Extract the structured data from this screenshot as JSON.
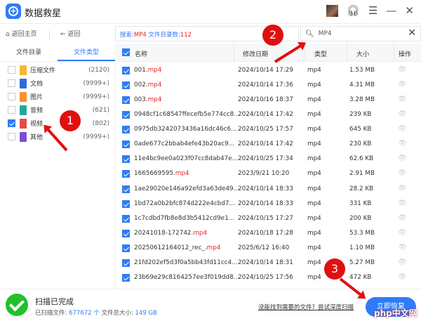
{
  "app": {
    "title": "数据救星",
    "logo_icon": "plus-circle-icon"
  },
  "toolbar": {
    "home": "返回主页",
    "back": "返回",
    "search_prefix": "搜索:",
    "search_term": "MP4",
    "dir_count_label": "文件目录数:",
    "dir_count": "112",
    "search_value": "MP4"
  },
  "left": {
    "tabs": [
      "文件目录",
      "文件类型"
    ],
    "active_tab": 1,
    "categories": [
      {
        "label": "压缩文件",
        "count": "(2120)",
        "checked": false,
        "color": "#f5b82e"
      },
      {
        "label": "文档",
        "count": "(9999+)",
        "checked": false,
        "color": "#2b6fd6"
      },
      {
        "label": "图片",
        "count": "(9999+)",
        "checked": false,
        "color": "#f7912e"
      },
      {
        "label": "音频",
        "count": "(621)",
        "checked": false,
        "color": "#23a79a"
      },
      {
        "label": "视频",
        "count": "(802)",
        "checked": true,
        "color": "#e84a4a"
      },
      {
        "label": "其他",
        "count": "(9999+)",
        "checked": false,
        "color": "#7a4fd0"
      }
    ]
  },
  "table": {
    "headers": [
      "名称",
      "修改日期",
      "类型",
      "大小",
      "操作"
    ],
    "rows": [
      {
        "name": "001.",
        "ext": "mp4",
        "date": "2024/10/14 17:29",
        "type": "mp4",
        "size": "1.53 MB"
      },
      {
        "name": "002.",
        "ext": "mp4",
        "date": "2024/10/14 17:36",
        "type": "mp4",
        "size": "4.31 MB"
      },
      {
        "name": "003.",
        "ext": "mp4",
        "date": "2024/10/16 18:37",
        "type": "mp4",
        "size": "3.28 MB"
      },
      {
        "name": "0948cf1c68547ffecefb5e774cc8...",
        "ext": "",
        "date": "2024/10/14 17:42",
        "type": "mp4",
        "size": "239 KB"
      },
      {
        "name": "0975db3242073436a16dc46c6...",
        "ext": "",
        "date": "2024/10/25 17:57",
        "type": "mp4",
        "size": "645 KB"
      },
      {
        "name": "0ade677c2bbab4efe43b20ac9...",
        "ext": "",
        "date": "2024/10/14 17:42",
        "type": "mp4",
        "size": "230 KB"
      },
      {
        "name": "11e4bc9ee0a023f07cc8dab47e...",
        "ext": "",
        "date": "2024/10/25 17:34",
        "type": "mp4",
        "size": "62.6 KB"
      },
      {
        "name": "1665669595.",
        "ext": "mp4",
        "date": "2023/9/21 10:20",
        "type": "mp4",
        "size": "2.91 MB"
      },
      {
        "name": "1ae29020e146a92efd3a63de49...",
        "ext": "",
        "date": "2024/10/14 18:33",
        "type": "mp4",
        "size": "28.2 KB"
      },
      {
        "name": "1bd72a0b2bfc874d222e4cbd7...",
        "ext": "",
        "date": "2024/10/14 18:33",
        "type": "mp4",
        "size": "331 KB"
      },
      {
        "name": "1c7cdbd7fb8e8d3b5412cd9e1...",
        "ext": "",
        "date": "2024/10/15 17:27",
        "type": "mp4",
        "size": "200 KB"
      },
      {
        "name": "20241018-172742.",
        "ext": "mp4",
        "date": "2024/10/18 17:28",
        "type": "mp4",
        "size": "53.3 MB"
      },
      {
        "name": "20250612164012_rec_.",
        "ext": "mp4",
        "date": "2025/6/12 16:40",
        "type": "mp4",
        "size": "1.10 MB"
      },
      {
        "name": "21fd202ef5d3f0a5bb43fd11cc4...",
        "ext": "",
        "date": "2024/10/14 18:31",
        "type": "mp4",
        "size": "5.27 MB"
      },
      {
        "name": "23b69e29c8164257ee3f019dd8...",
        "ext": "",
        "date": "2024/10/25 17:56",
        "type": "mp4",
        "size": "472 KB"
      }
    ]
  },
  "footer": {
    "title": "扫描已完成",
    "scanned_label": "已扫描文件:",
    "scanned_count": "677672",
    "unit": "个",
    "total_label": "文件总大小:",
    "total_size": "149 GB",
    "deep_link": "没能找到需要的文件？尝试深度扫描",
    "recover": "立即恢复"
  },
  "annotations": [
    "1",
    "2",
    "3"
  ],
  "watermark": "php中文网",
  "colors": {
    "accent": "#2f7cf6",
    "highlight": "#ee2222",
    "success": "#22c02a"
  }
}
